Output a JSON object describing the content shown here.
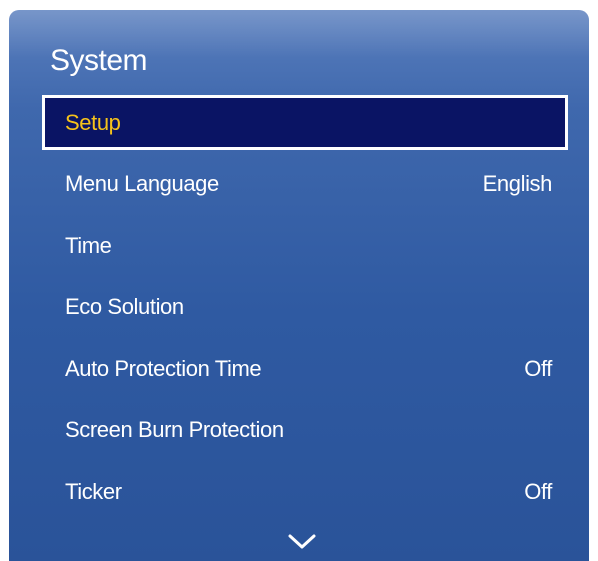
{
  "menu": {
    "title": "System",
    "items": [
      {
        "label": "Setup",
        "value": "",
        "selected": true
      },
      {
        "label": "Menu Language",
        "value": "English"
      },
      {
        "label": "Time",
        "value": ""
      },
      {
        "label": "Eco Solution",
        "value": ""
      },
      {
        "label": "Auto Protection Time",
        "value": "Off"
      },
      {
        "label": "Screen Burn Protection",
        "value": ""
      },
      {
        "label": "Ticker",
        "value": "Off"
      }
    ],
    "scroll_indicator": "chevron-down-icon"
  },
  "colors": {
    "panel_blue": "#2f5aa2",
    "selected_bg": "#0a1464",
    "selected_text": "#f5c21b",
    "text": "#ffffff"
  }
}
